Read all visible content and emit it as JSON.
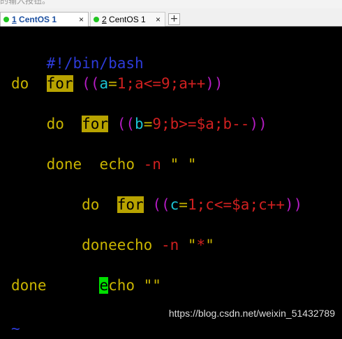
{
  "header_strip": {
    "text": "的输入按钮。"
  },
  "tabs": [
    {
      "number": "1",
      "title": " CentOS 1",
      "close": "×",
      "active": true
    },
    {
      "number": "2",
      "title": " CentOS 1",
      "close": "×",
      "active": false
    }
  ],
  "new_tab_label": "+",
  "colors": {
    "keyword_bg": "#b8a300",
    "cursor_bg": "#00e000",
    "comment": "#2d3bd9",
    "paren": "#b51cc4",
    "variable": "#1cc4d2",
    "number": "#d02020",
    "text": "#c9b400",
    "status_dot": "#21c521"
  },
  "code": {
    "l1": {
      "shebang": "#!/bin/bash"
    },
    "l2": {
      "kw": "for",
      "sp": " ",
      "p1": "((",
      "v": "a",
      "eq": "=",
      "rest": "1;a<=9;a++",
      "p2": "))"
    },
    "l3": {
      "text": "do"
    },
    "l4": {
      "indent": "    ",
      "kw": "for",
      "sp": " ",
      "p1": "((",
      "v": "b",
      "eq": "=",
      "rest": "9;b>=$a;b--",
      "p2": "))"
    },
    "l5": {
      "text": "    do"
    },
    "l6": {
      "indent": "      ",
      "cmd": "echo ",
      "flag": "-n",
      "str": " \" \""
    },
    "l7": {
      "text": "    done"
    },
    "l8": {
      "indent": "        ",
      "kw": "for",
      "sp": " ",
      "p1": "((",
      "v": "c",
      "eq": "=",
      "rest": "1;c<=$a;c++",
      "p2": "))"
    },
    "l9": {
      "text": "        do"
    },
    "l10": {
      "indent": "        ",
      "cmd": "echo ",
      "flag": "-n",
      "q1": " \"",
      "star": "*",
      "q2": "\""
    },
    "l11": {
      "text": "        done"
    },
    "l12": {
      "indent": "      ",
      "cursor_char": "e",
      "rest": "cho \"\""
    },
    "l13": {
      "text": "done"
    }
  },
  "watermark": "https://blog.csdn.net/weixin_51432789",
  "tilde": "~"
}
